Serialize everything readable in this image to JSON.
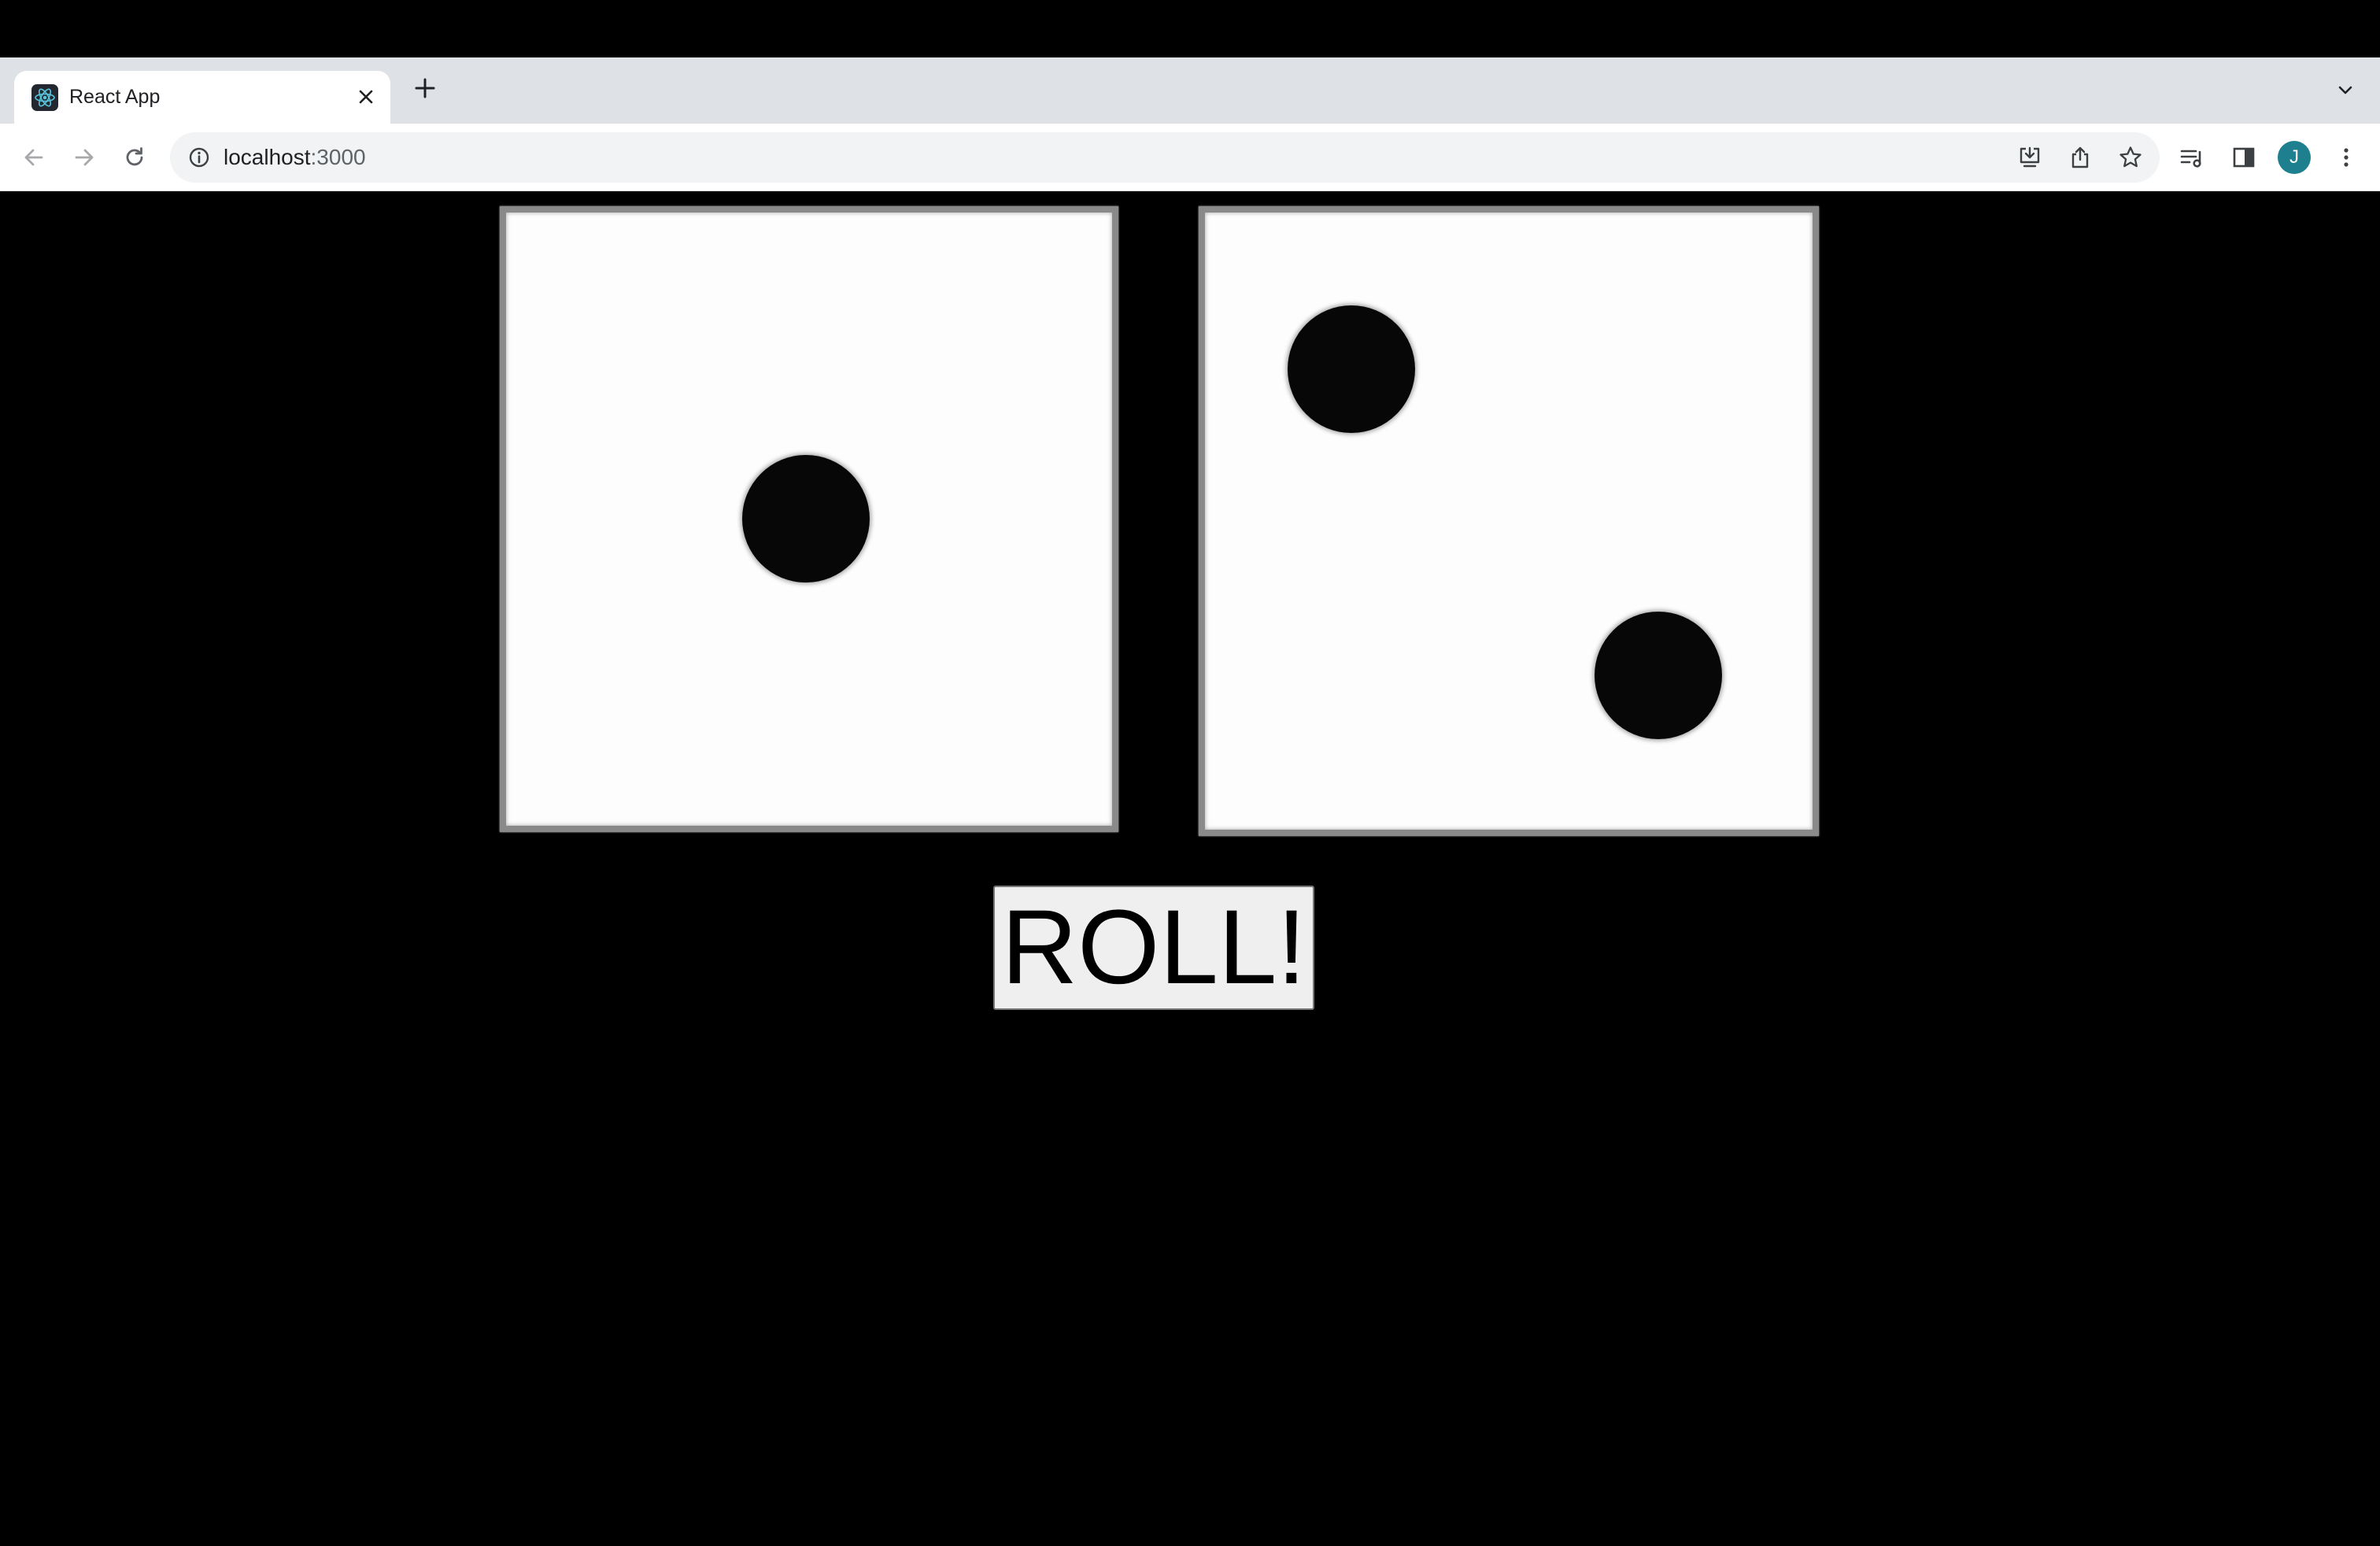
{
  "browser": {
    "tab": {
      "title": "React App",
      "favicon": "react-logo-icon",
      "close_icon": "close-icon"
    },
    "new_tab_icon": "plus-icon",
    "tab_strip_menu_icon": "chevron-down-icon",
    "nav": {
      "back_icon": "arrow-left-icon",
      "forward_icon": "arrow-right-icon",
      "reload_icon": "reload-icon"
    },
    "address_bar": {
      "site_info_icon": "info-icon",
      "host": "localhost",
      "port": ":3000"
    },
    "toolbar_icons": [
      "install-icon",
      "share-icon",
      "star-icon",
      "reading-list-icon",
      "side-panel-icon",
      "kebab-menu-icon"
    ],
    "profile_initial": "J",
    "colors": {
      "tab_strip": "#dee1e6",
      "omnibox": "#f1f3f4",
      "avatar": "#1e7f8f"
    }
  },
  "page": {
    "background": "#000000",
    "dice": [
      {
        "value": 1
      },
      {
        "value": 2
      }
    ],
    "roll_button_label": "ROLL!"
  }
}
